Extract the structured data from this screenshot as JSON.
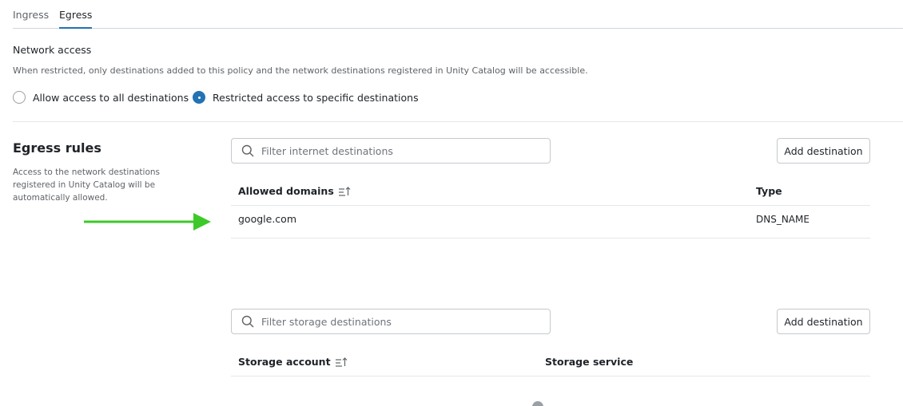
{
  "tabs": [
    {
      "label": "Ingress",
      "active": false
    },
    {
      "label": "Egress",
      "active": true
    }
  ],
  "network_access": {
    "title": "Network access",
    "description": "When restricted, only destinations added to this policy and the network destinations registered in Unity Catalog will be accessible.",
    "options": [
      {
        "label": "Allow access to all destinations",
        "selected": false
      },
      {
        "label": "Restricted access to specific destinations",
        "selected": true
      }
    ]
  },
  "egress_rules": {
    "title": "Egress rules",
    "description": "Access to the network destinations registered in Unity Catalog will be automatically allowed."
  },
  "internet": {
    "search_placeholder": "Filter internet destinations",
    "add_label": "Add destination",
    "columns": [
      "Allowed domains",
      "Type"
    ],
    "rows": [
      {
        "domain": "google.com",
        "type": "DNS_NAME"
      }
    ]
  },
  "storage": {
    "search_placeholder": "Filter storage destinations",
    "add_label": "Add destination",
    "columns": [
      "Storage account",
      "Storage service"
    ],
    "rows": []
  },
  "colors": {
    "accent": "#2272b4",
    "annotation_arrow": "#3ec92a"
  },
  "icons": [
    "search-icon",
    "sort-icon",
    "arrow-right-icon"
  ]
}
